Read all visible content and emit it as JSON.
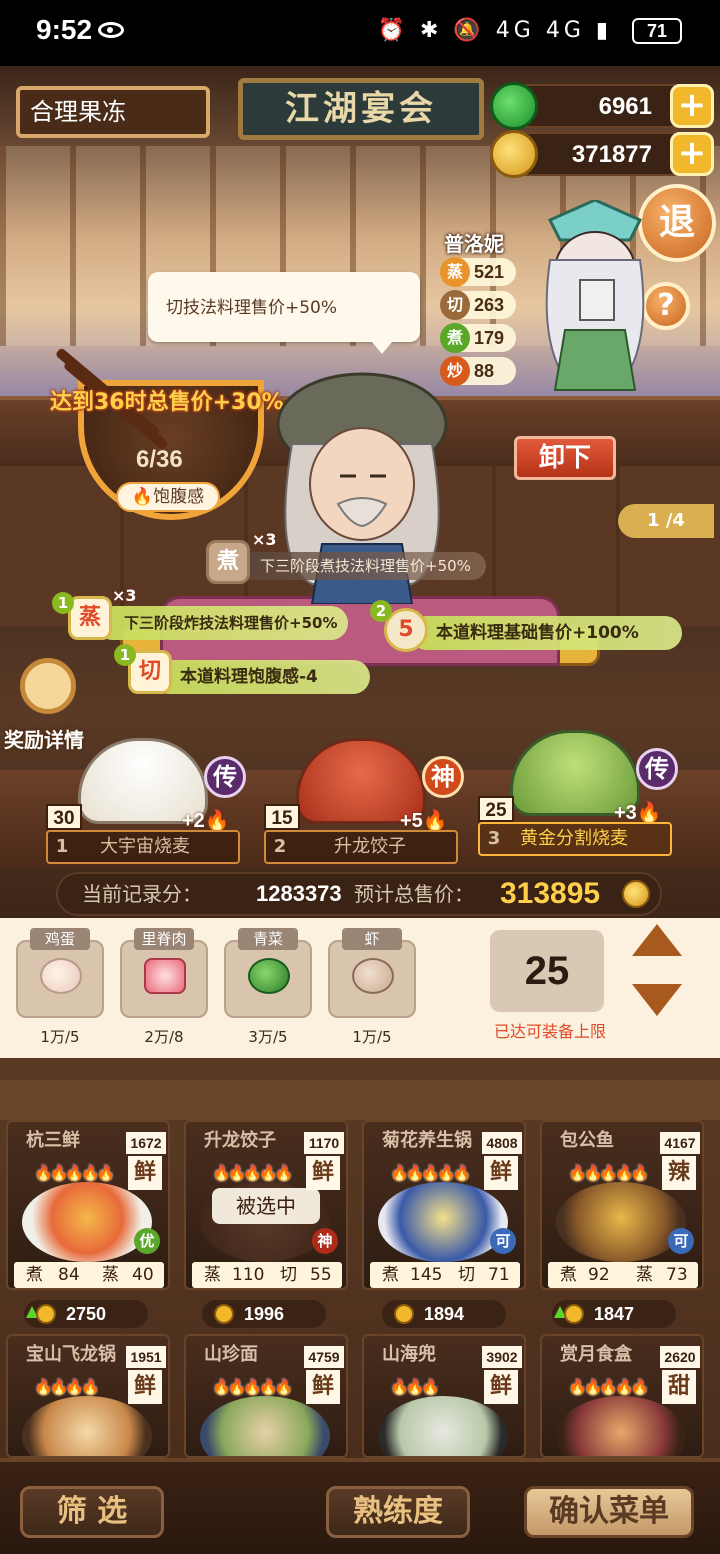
{
  "status_bar": {
    "time": "9:52",
    "network": "4G 4G",
    "battery": "71"
  },
  "header": {
    "team_name": "合理果冻",
    "title": "江湖宴会",
    "jade": "6961",
    "coins": "371877",
    "exit_label": "退",
    "help_label": "?"
  },
  "chef": {
    "name": "普洛妮",
    "stats": [
      {
        "icon": "蒸",
        "value": "521",
        "color": "#e8942a"
      },
      {
        "icon": "切",
        "value": "263",
        "color": "#9a6a3a"
      },
      {
        "icon": "煮",
        "value": "179",
        "color": "#5aa82a"
      },
      {
        "icon": "炒",
        "value": "88",
        "color": "#d85a1a"
      }
    ],
    "unload_label": "卸下",
    "page": "1 /4"
  },
  "tooltip": "切技法料理售价+50%",
  "fullness": {
    "goal": "达到36时总售价+30%",
    "count": "6/36",
    "label": "饱腹感"
  },
  "buffs": {
    "b1": {
      "icon": "煮",
      "mult": "×3",
      "text": "下三阶段煮技法料理售价+50%"
    },
    "b2": {
      "num": "1",
      "icon": "蒸",
      "mult": "×3",
      "text": "下三阶段炸技法料理售价+50%"
    },
    "b3": {
      "num": "2",
      "icon": "5",
      "text": "本道料理基础售价+100%"
    },
    "b4": {
      "num": "1",
      "icon": "切",
      "text": "本道料理饱腹感-4"
    }
  },
  "reward_label": "奖励详情",
  "dishes": [
    {
      "count": "30",
      "grade": "传",
      "heat": "+2",
      "index": "1",
      "name": "大宇宙烧麦"
    },
    {
      "count": "15",
      "grade": "神",
      "heat": "+5",
      "index": "2",
      "name": "升龙饺子"
    },
    {
      "count": "25",
      "grade": "传",
      "heat": "+3",
      "index": "3",
      "name": "黄金分割烧麦"
    }
  ],
  "score": {
    "record_label": "当前记录分：",
    "record_value": "1283373",
    "total_label": "预计总售价：",
    "total_value": "313895"
  },
  "ingredients": [
    {
      "name": "鸡蛋",
      "qty": "1万/5"
    },
    {
      "name": "里脊肉",
      "qty": "2万/8"
    },
    {
      "name": "青菜",
      "qty": "3万/5"
    },
    {
      "name": "虾",
      "qty": "1万/5"
    }
  ],
  "capacity": {
    "value": "25",
    "note": "已达可装备上限"
  },
  "recipes": [
    {
      "name": "杭三鲜",
      "price_num": "1672",
      "flavor": "鲜",
      "badge": "优",
      "s1": "煮",
      "v1": "84",
      "s2": "蒸",
      "v2": "40",
      "price": "2750"
    },
    {
      "name": "升龙饺子",
      "price_num": "1170",
      "flavor": "鲜",
      "badge": "神",
      "s1": "蒸",
      "v1": "110",
      "s2": "切",
      "v2": "55",
      "price": "1996"
    },
    {
      "name": "菊花养生锅",
      "price_num": "4808",
      "flavor": "鲜",
      "badge": "可",
      "s1": "煮",
      "v1": "145",
      "s2": "切",
      "v2": "71",
      "price": "1894"
    },
    {
      "name": "包公鱼",
      "price_num": "4167",
      "flavor": "辣",
      "badge": "可",
      "s1": "煮",
      "v1": "92",
      "s2": "蒸",
      "v2": "73",
      "price": "1847"
    },
    {
      "name": "宝山飞龙锅",
      "price_num": "1951",
      "flavor": "鲜"
    },
    {
      "name": "山珍面",
      "price_num": "4759",
      "flavor": "鲜"
    },
    {
      "name": "山海兜",
      "price_num": "3902",
      "flavor": "鲜"
    },
    {
      "name": "赏月食盒",
      "price_num": "2620",
      "flavor": "甜"
    }
  ],
  "selected_label": "被选中",
  "bottom": {
    "filter": "筛 选",
    "proficiency": "熟练度",
    "confirm": "确认菜单"
  }
}
